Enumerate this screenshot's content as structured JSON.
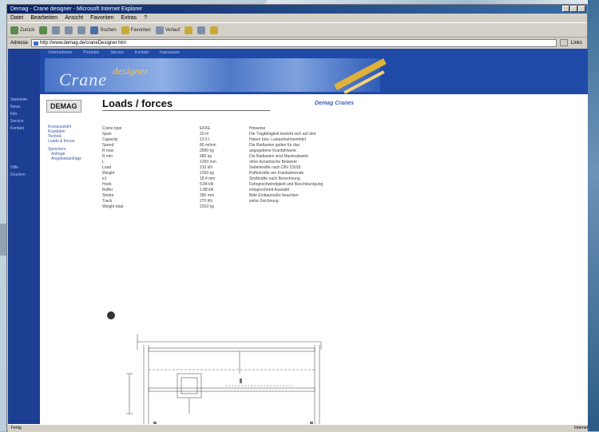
{
  "window": {
    "title": "Demag - Crane designer - Microsoft Internet Explorer"
  },
  "menu": [
    "Datei",
    "Bearbeiten",
    "Ansicht",
    "Favoriten",
    "Extras",
    "?"
  ],
  "toolbar": {
    "back": "Zurück",
    "forward": "",
    "search": "Suchen",
    "favorites": "Favoriten",
    "history": "Verlauf"
  },
  "address": {
    "label": "Adresse",
    "value": "http://www.demag.de/craneDesigner.htm",
    "links": "Links"
  },
  "nav": {
    "top_links": [
      "Unternehmen",
      "Produkte",
      "Service",
      "Kontakt",
      "Impressum"
    ],
    "left_items": [
      "Startseite",
      "News",
      "Info",
      "Service",
      "Kontakt",
      "",
      "Hilfe",
      "Drucken"
    ]
  },
  "banner": {
    "title": "Crane",
    "subtitle": "designer"
  },
  "sidebar": {
    "logo": "DEMAG",
    "links_a": [
      "Kranauswahl",
      "Kranbahn",
      "Technik",
      "Loads & forces"
    ],
    "links_b": [
      "Speichern",
      "Anfrage",
      "Angebotsanfrage"
    ]
  },
  "main": {
    "title": "Loads / forces",
    "brand_link": "Demag Cranes",
    "table_rows": [
      [
        "Crane type",
        "EKKE",
        "Hinweise"
      ],
      [
        "Span",
        "20 m",
        "Die Tragfähigkeit bezieht sich auf den"
      ],
      [
        "Capacity",
        "12.5 t",
        "Haken bzw. Lastaufnahmemittel"
      ],
      [
        "Speed",
        "80 m/min",
        "Die Radlasten gelten für das"
      ],
      [
        "R max",
        "2890 kg",
        "angegebene Kranfahrwerk"
      ],
      [
        "R min",
        "980 kg",
        "Die Radlasten sind Maximalwerte"
      ],
      [
        "L",
        "1200 mm",
        "ohne dynamische Beiwerte"
      ],
      [
        "Load",
        "210 kN",
        "Seitenkräfte nach DIN 15018"
      ],
      [
        "Weight",
        "1250 kg",
        "Pufferkräfte am Kranbahnende"
      ],
      [
        "e1",
        "18.4 mm",
        "Stoßkräfte nach Berechnung"
      ],
      [
        "Hook",
        "5.84 kN",
        "Fahrgeschwindigkeit und Beschleunigung"
      ],
      [
        "Buffer",
        "1.88 kN",
        "entsprechend Auswahl"
      ],
      [
        "Stroke",
        "280 mm",
        "Bitte Einbaumaße beachten"
      ],
      [
        "Track",
        "270 kN",
        "siehe Zeichnung"
      ],
      [
        "Weight total",
        "2310 kg",
        ""
      ]
    ]
  },
  "status": {
    "left": "Fertig",
    "right": "Internet"
  }
}
